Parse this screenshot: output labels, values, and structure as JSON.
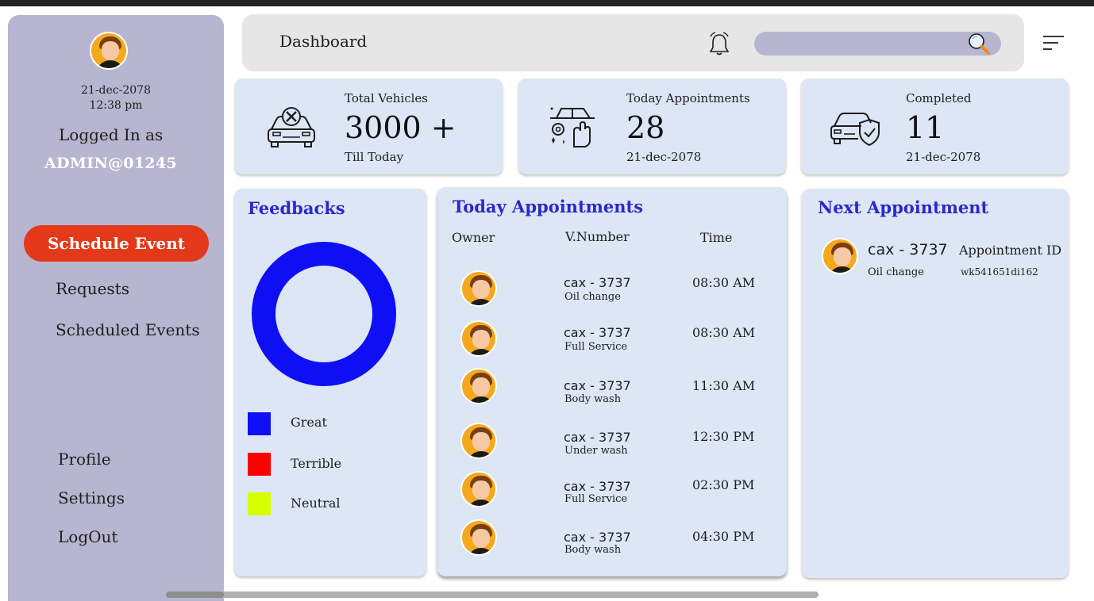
{
  "sidebar": {
    "date": "21-dec-2078",
    "time": "12:38 pm",
    "logged_in_label": "Logged In as",
    "username": "ADMIN@01245",
    "primary_button": "Schedule Event",
    "nav": [
      "Requests",
      "Scheduled Events"
    ],
    "bottom_nav": [
      "Profile",
      "Settings",
      "LogOut"
    ]
  },
  "header": {
    "title": "Dashboard",
    "search_placeholder": "",
    "icons": [
      "bell-icon",
      "search-icon",
      "menu-icon"
    ]
  },
  "stats": [
    {
      "label": "Total Vehicles",
      "value": "3000 +",
      "sub": "Till Today",
      "icon": "car-repair-icon"
    },
    {
      "label": "Today Appointments",
      "value": "28",
      "sub": "21-dec-2078",
      "icon": "car-wash-icon"
    },
    {
      "label": "Completed",
      "value": "11",
      "sub": "21-dec-2078",
      "icon": "car-shield-icon"
    }
  ],
  "feedbacks": {
    "title": "Feedbacks",
    "legend": [
      {
        "label": "Great",
        "color": "#0f0ff5"
      },
      {
        "label": "Terrible",
        "color": "#ff0000"
      },
      {
        "label": "Neutral",
        "color": "#d6ff00"
      }
    ]
  },
  "today_appointments": {
    "title": "Today Appointments",
    "columns": [
      "Owner",
      "V.Number",
      "Time"
    ],
    "rows": [
      {
        "vnumber": "cax - 3737",
        "service": "Oil change",
        "time": "08:30 AM"
      },
      {
        "vnumber": "cax - 3737",
        "service": "Full Service",
        "time": "08:30 AM"
      },
      {
        "vnumber": "cax - 3737",
        "service": "Body wash",
        "time": "11:30 AM"
      },
      {
        "vnumber": "cax - 3737",
        "service": "Under wash",
        "time": "12:30 PM"
      },
      {
        "vnumber": "cax - 3737",
        "service": "Full Service",
        "time": "02:30 PM"
      },
      {
        "vnumber": "cax - 3737",
        "service": "Body wash",
        "time": "04:30 PM"
      }
    ]
  },
  "next_appointment": {
    "title": "Next Appointment",
    "vnumber": "cax - 3737",
    "service": "Oil change",
    "id_label": "Appointment ID",
    "id_value": "wk541651di162"
  },
  "colors": {
    "sidebar": "#b8b5d0",
    "card": "#dce6f5",
    "accent": "#e3391a",
    "title": "#2a2ac8"
  }
}
